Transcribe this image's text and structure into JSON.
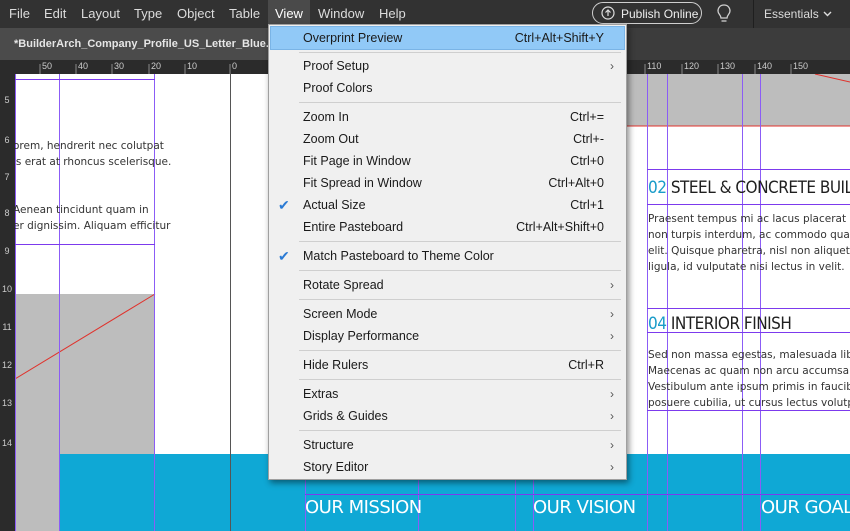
{
  "menubar": {
    "items": [
      "File",
      "Edit",
      "Layout",
      "Type",
      "Object",
      "Table",
      "View",
      "Window",
      "Help"
    ],
    "publish_label": "Publish Online",
    "workspace_label": "Essentials"
  },
  "document_tab": {
    "title": "*BuilderArch_Company_Profile_US_Letter_Blue.indd"
  },
  "ruler": {
    "h_labels": [
      "50",
      "40",
      "30",
      "20",
      "10",
      "0",
      "110",
      "120",
      "130",
      "140",
      "150"
    ],
    "v_labels": [
      "5",
      "6",
      "7",
      "8",
      "9",
      "10",
      "11",
      "12",
      "13",
      "14"
    ]
  },
  "page_left": {
    "text_block_1": [
      "orem, hendrerit nec   colutpat",
      "is erat at rhoncus scelerisque."
    ],
    "text_block_2": [
      "Aenean tincidunt quam in",
      "er dignissim. Aliquam efficitur"
    ]
  },
  "page_right": {
    "heading_1_num": "02",
    "heading_1_text": " STEEL & CONCRETE BUILDI",
    "text_1": [
      "Praesent tempus mi ac lacus placerat ultricie",
      "non turpis interdum, ac commodo quam rhon",
      "elit. Quisque pharetra, nisl non aliquet lobo",
      "ligula, id vulputate nisi lectus in velit."
    ],
    "heading_2_num": "04",
    "heading_2_text": " INTERIOR FINISH",
    "text_2": [
      "Sed non massa egestas, malesuada libero qu",
      "Maecenas ac quam non arcu accumsan trist",
      "Vestibulum ante ipsum primis in faucibus or",
      "posuere cubilia, ut cursus lectus volutpat."
    ]
  },
  "bottom_band": {
    "mission": "OUR MISSION",
    "vision": "OUR VISION",
    "goals": "OUR GOALS"
  },
  "view_menu": {
    "items": [
      {
        "label": "Overprint Preview",
        "shortcut": "Ctrl+Alt+Shift+Y",
        "highlighted": true
      },
      {
        "label": "Proof Setup",
        "submenu": true
      },
      {
        "label": "Proof Colors"
      },
      {
        "label": "Zoom In",
        "shortcut": "Ctrl+="
      },
      {
        "label": "Zoom Out",
        "shortcut": "Ctrl+-"
      },
      {
        "label": "Fit Page in Window",
        "shortcut": "Ctrl+0"
      },
      {
        "label": "Fit Spread in Window",
        "shortcut": "Ctrl+Alt+0"
      },
      {
        "label": "Actual Size",
        "shortcut": "Ctrl+1",
        "checked": true
      },
      {
        "label": "Entire Pasteboard",
        "shortcut": "Ctrl+Alt+Shift+0"
      },
      {
        "label": "Match Pasteboard to Theme Color",
        "checked": true
      },
      {
        "label": "Rotate Spread",
        "submenu": true
      },
      {
        "label": "Screen Mode",
        "submenu": true
      },
      {
        "label": "Display Performance",
        "submenu": true
      },
      {
        "label": "Hide Rulers",
        "shortcut": "Ctrl+R"
      },
      {
        "label": "Extras",
        "submenu": true
      },
      {
        "label": "Grids & Guides",
        "submenu": true
      },
      {
        "label": "Structure",
        "submenu": true
      },
      {
        "label": "Story Editor",
        "submenu": true
      }
    ],
    "check_glyph": "✔",
    "submenu_glyph": "›"
  },
  "icons": {
    "publish": "globe-upload-icon",
    "bulb": "lightbulb-icon",
    "workspace_chevron": "chevron-down-icon"
  },
  "colors": {
    "accent_teal": "#0fa8d5",
    "menu_highlight": "#91c9f7",
    "heading_number": "#1a9cc9"
  }
}
